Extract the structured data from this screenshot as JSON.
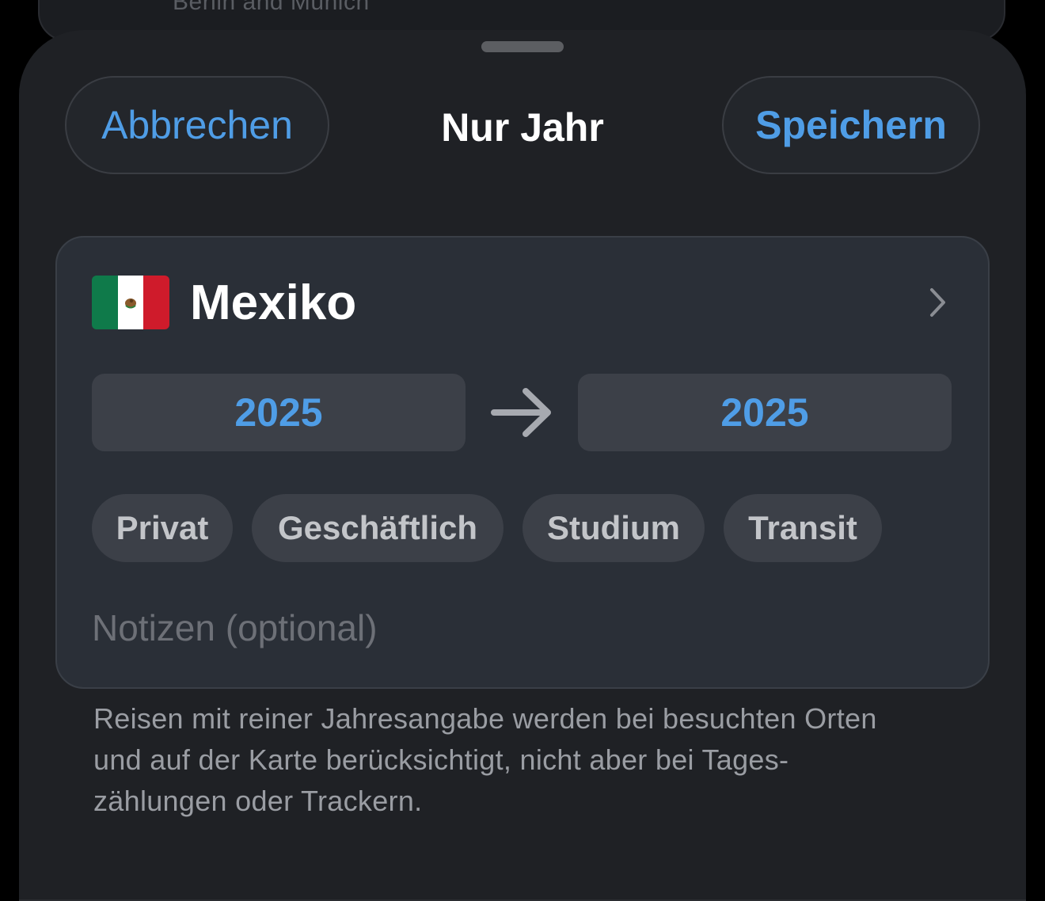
{
  "background_card": {
    "text": "Berlin and Munich"
  },
  "sheet": {
    "title": "Nur Jahr",
    "cancel_label": "Abbrechen",
    "save_label": "Speichern"
  },
  "trip": {
    "country": "Mexiko",
    "flag_icon": "mexico-flag-icon",
    "year_from": "2025",
    "year_to": "2025",
    "tags": [
      "Privat",
      "Geschäftlich",
      "Studium",
      "Transit"
    ],
    "notes_placeholder": "Notizen (optional)",
    "notes_value": ""
  },
  "footnote": {
    "lines": [
      "Reisen mit reiner Jahresangabe werden bei besuchten Orten",
      "und auf der Karte berücksichtigt, nicht aber bei Tages-",
      "zählungen oder Trackern."
    ]
  },
  "colors": {
    "accent": "#4f9de6",
    "sheet_bg": "#1f2125",
    "card_bg": "#2a2f37",
    "chip_bg": "#3c4048"
  }
}
